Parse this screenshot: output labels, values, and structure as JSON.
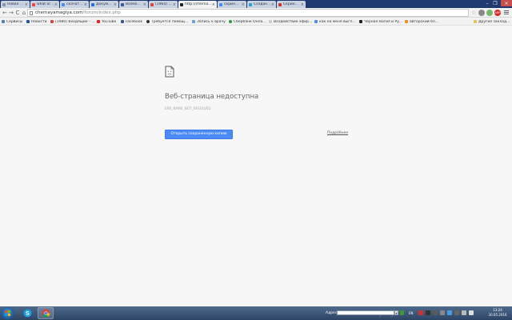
{
  "tabs": [
    {
      "title": "Новая вкладка"
    },
    {
      "title": "what ordered fo"
    },
    {
      "title": "скачать ip - По"
    },
    {
      "title": "Документ"
    },
    {
      "title": "Возможна проб"
    },
    {
      "title": "(1964) Входящи"
    },
    {
      "title": "http://chernayan"
    },
    {
      "title": "скриншот экран"
    },
    {
      "title": "Создание скрин"
    },
    {
      "title": "Скриншот (Scre"
    }
  ],
  "tab_close_glyph": "×",
  "window_controls": {
    "minimize": "–",
    "maximize": "❐",
    "close": "×"
  },
  "toolbar": {
    "back": "←",
    "forward": "→",
    "reload": "C",
    "home": "⌂"
  },
  "address_bar": {
    "host": "chernayamagiya.com",
    "path": "/forum/index.php"
  },
  "extensions": {
    "star": "☆",
    "badge_label": "ABP"
  },
  "bookmarks": [
    {
      "label": "Сервисы",
      "icon": "apps-icon"
    },
    {
      "label": "Новости",
      "icon": "news-icon"
    },
    {
      "label": "(1980) Входящие - ...",
      "icon": "mail-icon"
    },
    {
      "label": "YouTube",
      "icon": "youtube-icon"
    },
    {
      "label": "Facebook",
      "icon": "facebook-icon"
    },
    {
      "label": "Требуется помощь!...",
      "icon": "apple-icon"
    },
    {
      "label": "Запись к врачу",
      "icon": "doc-icon"
    },
    {
      "label": "Сбербанк Онлайн",
      "icon": "sber-icon"
    },
    {
      "label": "Воздействие эфирн...",
      "icon": "page-icon"
    },
    {
      "label": "как на меня выглял...",
      "icon": "google-icon"
    },
    {
      "label": "Черная магия и Ру...",
      "icon": "site-icon"
    },
    {
      "label": "авторский бл...",
      "icon": "blog-icon"
    },
    {
      "label": "Другие закладки",
      "icon": "folder-icon"
    }
  ],
  "error": {
    "title": "Веб-страница недоступна",
    "code": "ERR_NAME_NOT_RESOLVED",
    "button": "Открыть сохраненную копию",
    "details_link": "Подробнее"
  },
  "taskbar": {
    "apps": [
      {
        "name": "skype-icon"
      },
      {
        "name": "chrome-icon"
      }
    ],
    "address_label": "Адрес",
    "address_value": "",
    "address_dropdown": "▾",
    "language": "EN",
    "time": "13:24",
    "date": "30.05.2016"
  },
  "colors": {
    "tabstrip": "#1f3a6e",
    "accent_button": "#4c8bf5",
    "page_background": "#f7f7f7"
  }
}
